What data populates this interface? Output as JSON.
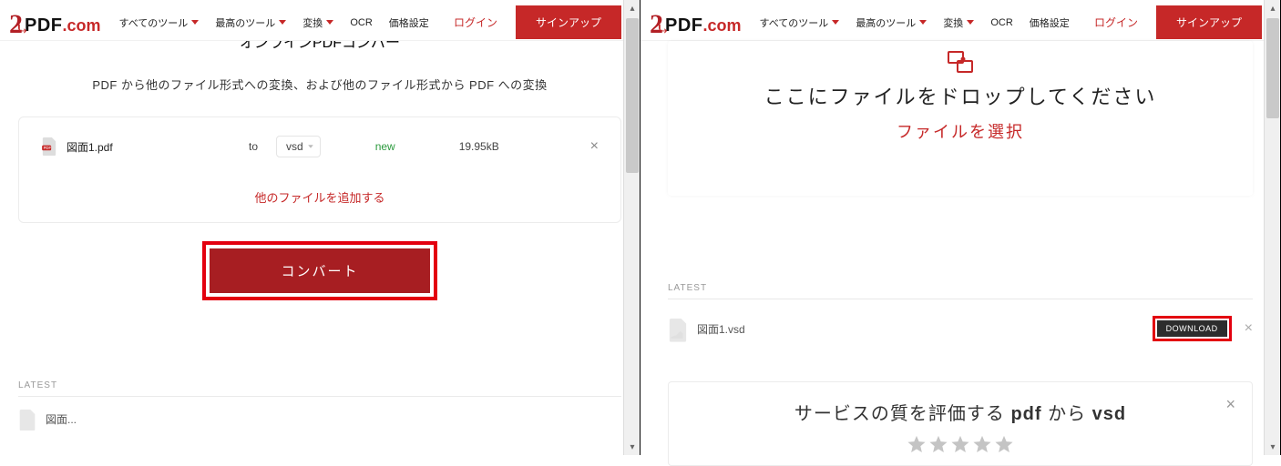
{
  "brand": {
    "num": "2",
    "pdf": "PDF",
    "com": ".com"
  },
  "nav": {
    "all_tools": "すべてのツール",
    "best_tools": "最高のツール",
    "convert": "変換",
    "ocr": "OCR",
    "pricing": "価格設定"
  },
  "auth": {
    "login": "ログイン",
    "signup": "サインアップ"
  },
  "left": {
    "headline": "オンラインPDFコンバー",
    "subline": "PDF から他のファイル形式への変換、および他のファイル形式から PDF への変換",
    "file": {
      "name": "図面1.pdf",
      "to_label": "to",
      "format": "vsd",
      "status": "new",
      "size": "19.95kB"
    },
    "add_more": "他のファイルを追加する",
    "convert": "コンバート",
    "latest_label": "LATEST",
    "latest_item": "図面..."
  },
  "right": {
    "drop_title": "ここにファイルをドロップしてください",
    "select_file": "ファイルを選択",
    "latest_label": "LATEST",
    "latest_item": "図面1.vsd",
    "download": "DOWNLOAD",
    "rating_prefix": "サービスの質を評価する ",
    "rating_from": "pdf",
    "rating_mid": " から ",
    "rating_to": "vsd"
  }
}
